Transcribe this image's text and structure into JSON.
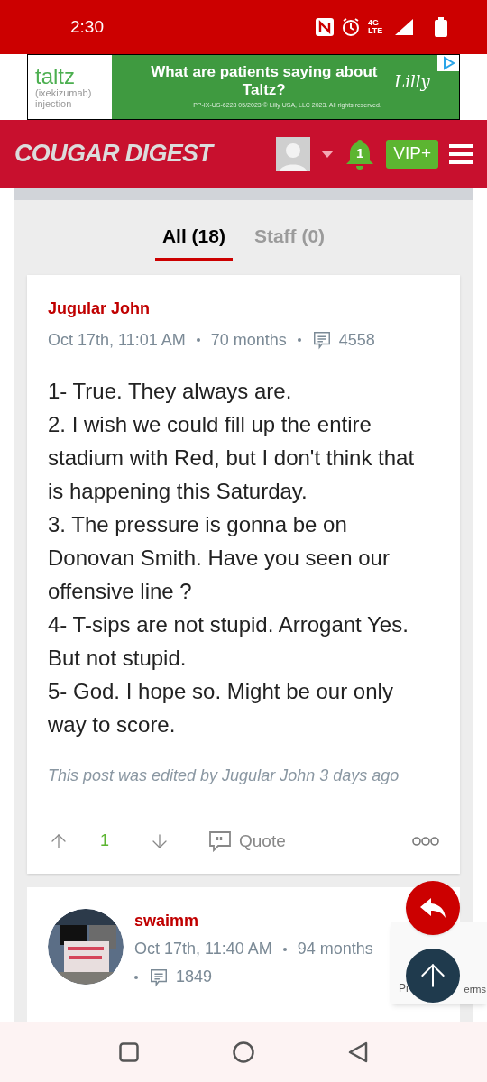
{
  "status_bar": {
    "time": "2:30",
    "network": "4G LTE"
  },
  "ad": {
    "brand": "taltz",
    "generic": "(ixekizumab)",
    "form": "injection",
    "headline": "What are patients saying about Taltz?",
    "legal": "PP-IX-US-6228 05/2023 © Lilly USA, LLC 2023. All rights reserved.",
    "sponsor": "Lilly"
  },
  "header": {
    "logo": "COUGAR DIGEST",
    "notifications": "1",
    "vip": "VIP+"
  },
  "tabs": [
    {
      "label": "All (18)",
      "selected": true
    },
    {
      "label": "Staff (0)",
      "selected": false
    }
  ],
  "posts": [
    {
      "author": "Jugular John",
      "date": "Oct 17th, 11:01 AM",
      "tenure": "70 months",
      "post_count": "4558",
      "has_avatar": false,
      "body": [
        "1- True. They always are.",
        "2. I wish we could fill up the entire stadium with Red, but I don't think that is happening this Saturday.",
        "3. The pressure is gonna be on Donovan Smith. Have you seen our offensive line ?",
        "4- T-sips are not stupid. Arrogant Yes. But not stupid.",
        "5- God. I hope so. Might be our only way to score."
      ],
      "edited": "This post was edited by Jugular John 3 days ago",
      "votes": "1",
      "quote": "Quote"
    },
    {
      "author": "swaimm",
      "date": "Oct 17th, 11:40 AM",
      "tenure": "94 months",
      "post_count": "1849",
      "has_avatar": true
    }
  ],
  "recaptcha": {
    "left": "Pr",
    "right": "erms"
  }
}
